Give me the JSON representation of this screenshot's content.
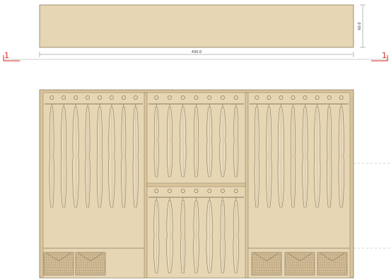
{
  "top_view": {
    "width_label": "430.0",
    "depth_label": "60.0"
  },
  "section_marks": {
    "left": "1",
    "right": "1"
  },
  "colors": {
    "wood": "#e6d6b4",
    "wood_dark": "#d9c49c",
    "outline": "#8a7a5c",
    "section_mark": "#d9261c",
    "dim_line": "#777777"
  },
  "front_view": {
    "compartments": [
      {
        "name": "left",
        "hanger_rows": [
          {
            "hangers": 8,
            "length": "long"
          }
        ],
        "baskets": 2
      },
      {
        "name": "middle",
        "hanger_rows": [
          {
            "hangers": 7,
            "length": "short"
          },
          {
            "hangers": 7,
            "length": "short"
          }
        ],
        "baskets": 0
      },
      {
        "name": "right",
        "hanger_rows": [
          {
            "hangers": 8,
            "length": "long"
          }
        ],
        "baskets": 3
      }
    ]
  }
}
